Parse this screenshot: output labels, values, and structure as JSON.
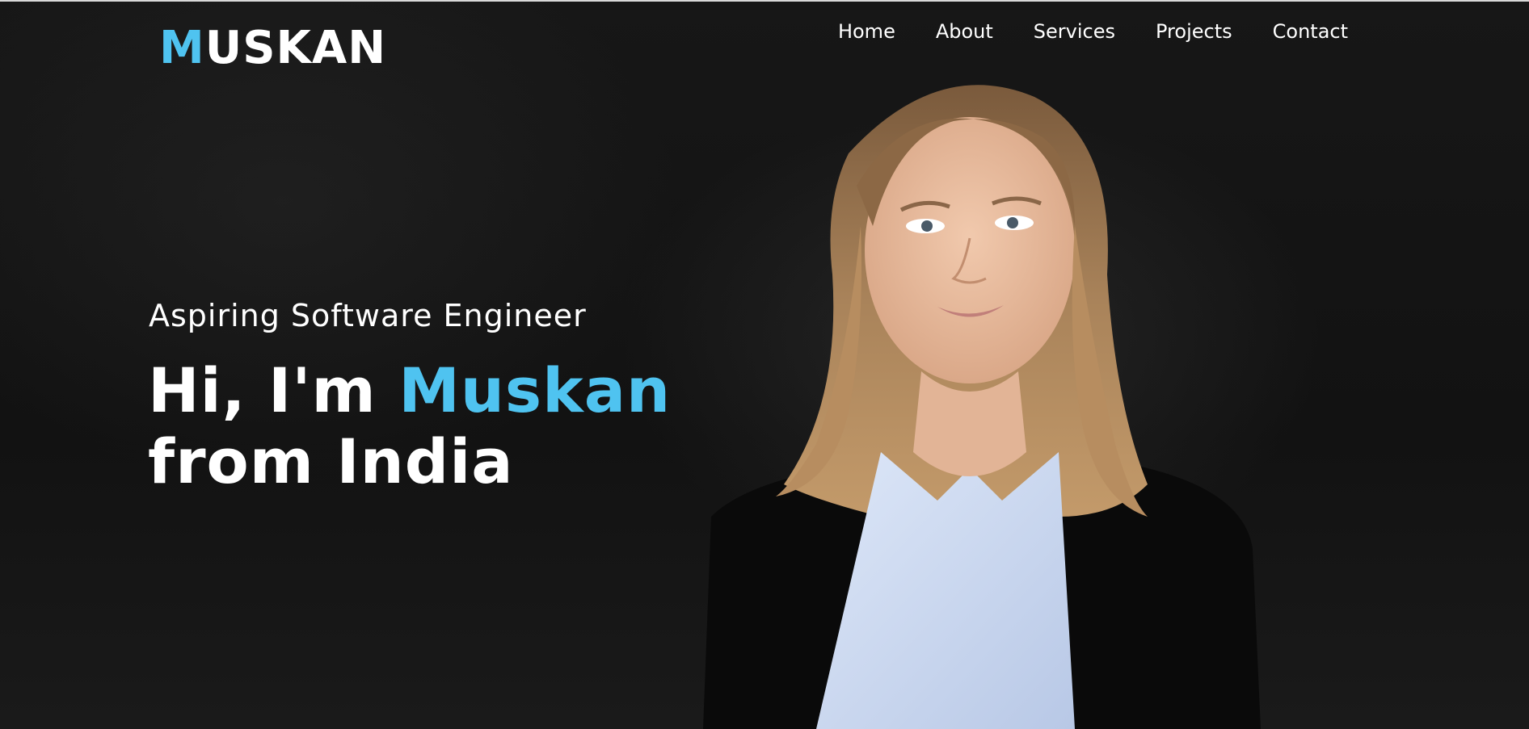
{
  "logo": {
    "first_letter": "M",
    "rest": "USKAN"
  },
  "nav": {
    "items": [
      {
        "label": "Home"
      },
      {
        "label": "About"
      },
      {
        "label": "Services"
      },
      {
        "label": "Projects"
      },
      {
        "label": "Contact"
      }
    ]
  },
  "hero": {
    "subtitle": "Aspiring Software Engineer",
    "greeting": "Hi, I'm ",
    "name": "Muskan",
    "line2": "from India"
  },
  "colors": {
    "accent": "#4fc3f0",
    "background": "#141414",
    "text": "#ffffff"
  }
}
